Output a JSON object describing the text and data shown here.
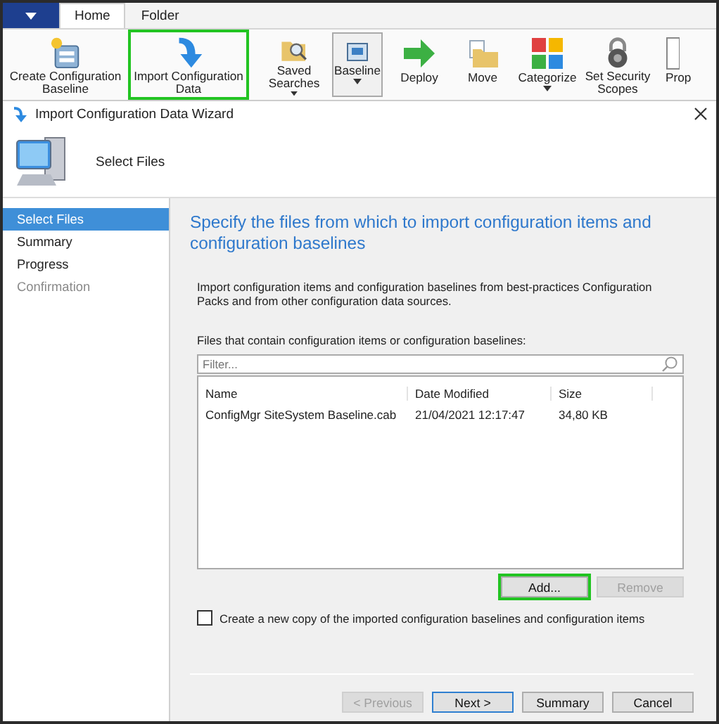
{
  "ribbon": {
    "tabs": [
      {
        "label": "Home",
        "selected": true
      },
      {
        "label": "Folder",
        "selected": false
      }
    ],
    "buttons": [
      {
        "label": "Create Configuration Baseline",
        "dropdown": false,
        "highlighted": false,
        "boxed": false
      },
      {
        "label": "Import Configuration Data",
        "dropdown": false,
        "highlighted": true,
        "boxed": false
      },
      {
        "label": "Saved Searches",
        "dropdown": true,
        "highlighted": false,
        "boxed": false
      },
      {
        "label": "Baseline",
        "dropdown": true,
        "highlighted": false,
        "boxed": true
      },
      {
        "label": "Deploy",
        "dropdown": false,
        "highlighted": false,
        "boxed": false
      },
      {
        "label": "Move",
        "dropdown": false,
        "highlighted": false,
        "boxed": false
      },
      {
        "label": "Categorize",
        "dropdown": true,
        "highlighted": false,
        "boxed": false
      },
      {
        "label": "Set Security Scopes",
        "dropdown": false,
        "highlighted": false,
        "boxed": false
      },
      {
        "label": "Prop",
        "dropdown": false,
        "highlighted": false,
        "boxed": false
      }
    ]
  },
  "wizard": {
    "title": "Import Configuration Data Wizard",
    "page_title": "Select Files",
    "steps": [
      {
        "label": "Select Files",
        "selected": true,
        "disabled": false
      },
      {
        "label": "Summary",
        "selected": false,
        "disabled": false
      },
      {
        "label": "Progress",
        "selected": false,
        "disabled": false
      },
      {
        "label": "Confirmation",
        "selected": false,
        "disabled": true
      }
    ],
    "heading": "Specify the files from which to import configuration items and configuration baselines",
    "description": "Import configuration items and configuration baselines from best-practices Configuration Packs and from other configuration data sources.",
    "list_label": "Files that contain configuration items or configuration baselines:",
    "filter": {
      "placeholder": "Filter..."
    },
    "columns": [
      "Name",
      "Date Modified",
      "Size"
    ],
    "rows": [
      [
        "ConfigMgr SiteSystem Baseline.cab",
        "21/04/2021 12:17:47",
        "34,80 KB"
      ]
    ],
    "list_buttons": [
      {
        "label": "Add...",
        "disabled": false,
        "highlighted": true
      },
      {
        "label": "Remove",
        "disabled": true,
        "highlighted": false
      }
    ],
    "copy_option": {
      "label": "Create a new copy of the imported configuration baselines and configuration items",
      "checked": false
    },
    "footer_buttons": [
      {
        "label": "< Previous",
        "disabled": true,
        "default": false
      },
      {
        "label": "Next >",
        "disabled": false,
        "default": true
      },
      {
        "label": "Summary",
        "disabled": false,
        "default": false
      },
      {
        "label": "Cancel",
        "disabled": false,
        "default": false
      }
    ]
  }
}
